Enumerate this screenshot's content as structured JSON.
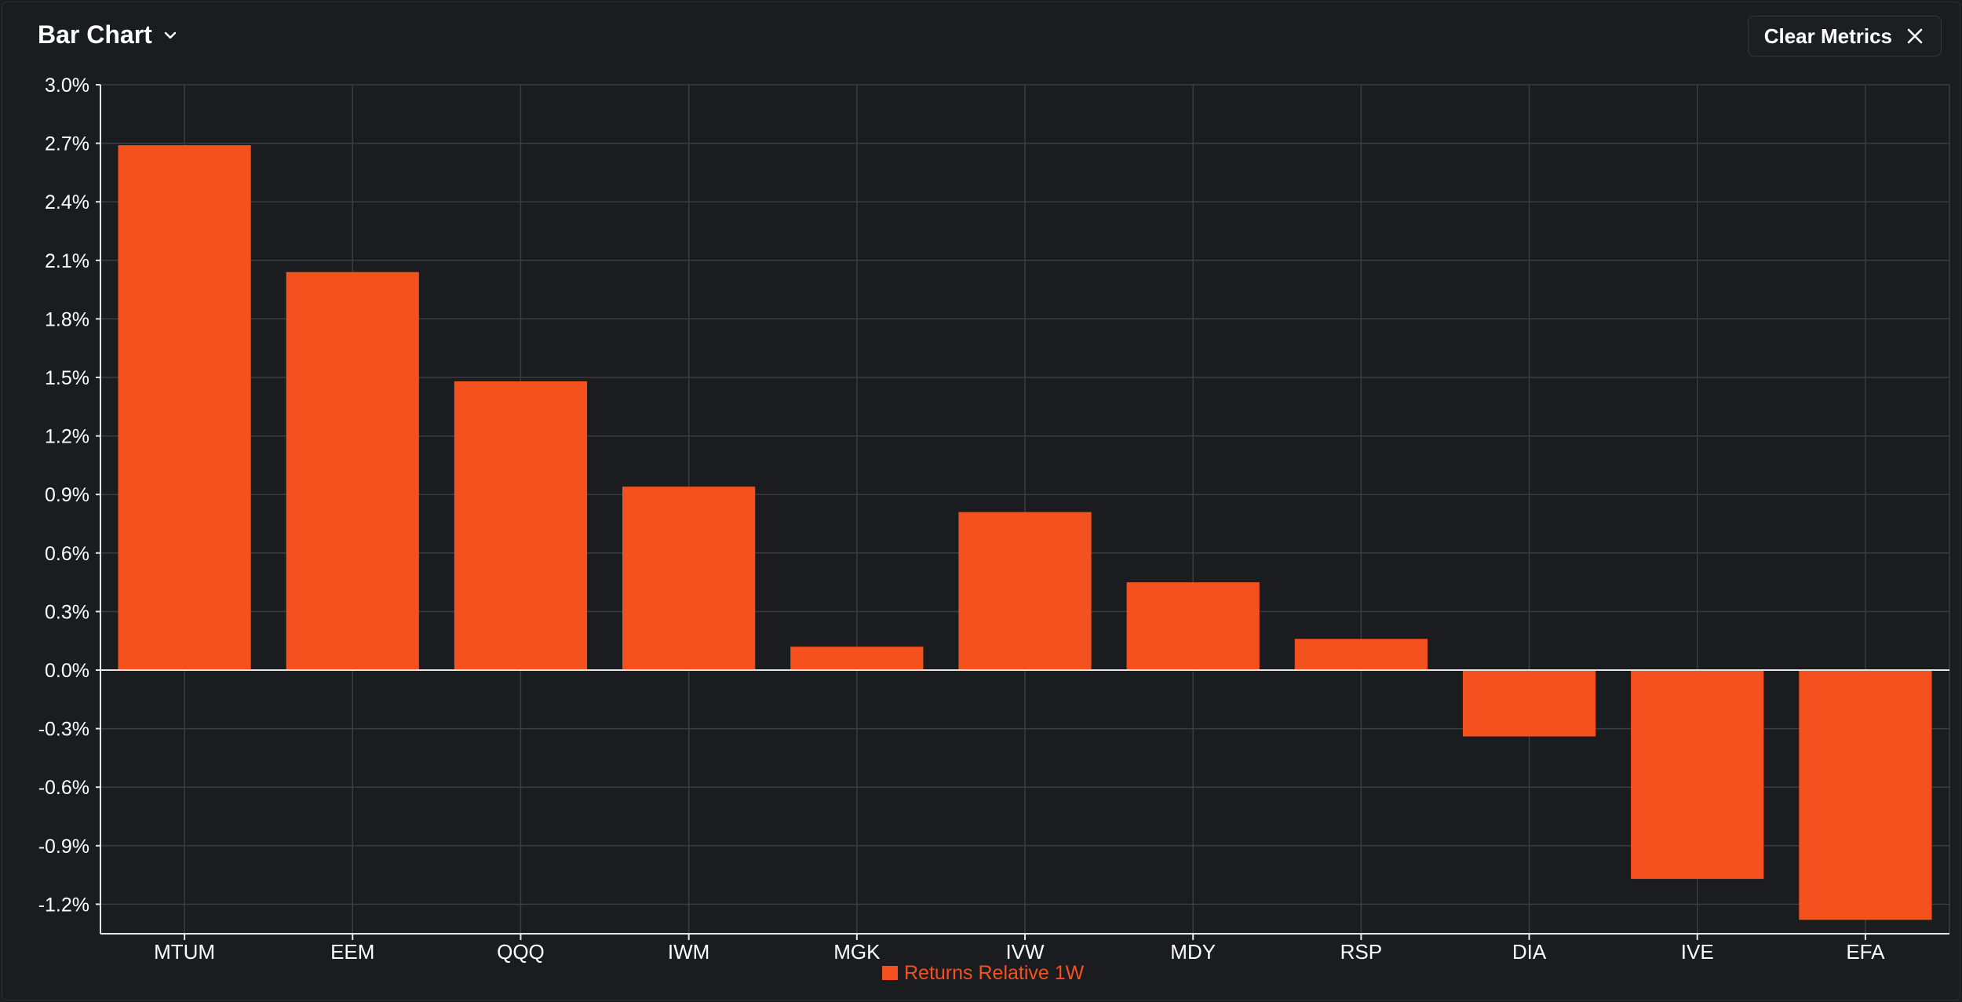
{
  "header": {
    "title": "Bar Chart",
    "title_icon": "chevron-down-icon",
    "clear_label": "Clear Metrics",
    "clear_icon": "close-icon"
  },
  "colors": {
    "bar": "#f4511e",
    "background": "#1b1c1f",
    "grid": "#3a3d42",
    "axis": "#e6e6e6",
    "text": "#ffffff"
  },
  "chart_data": {
    "type": "bar",
    "categories": [
      "MTUM",
      "EEM",
      "QQQ",
      "IWM",
      "MGK",
      "IVW",
      "MDY",
      "RSP",
      "DIA",
      "IVE",
      "EFA"
    ],
    "series": [
      {
        "name": "Returns Relative 1W",
        "values": [
          2.69,
          2.04,
          1.48,
          0.94,
          0.12,
          0.81,
          0.45,
          0.16,
          -0.34,
          -1.07,
          -1.28
        ]
      }
    ],
    "yticks": [
      3.0,
      2.7,
      2.4,
      2.1,
      1.8,
      1.5,
      1.2,
      0.9,
      0.6,
      0.3,
      0.0,
      -0.3,
      -0.6,
      -0.9,
      -1.2
    ],
    "ytick_labels": [
      "3.0%",
      "2.7%",
      "2.4%",
      "2.1%",
      "1.8%",
      "1.5%",
      "1.2%",
      "0.9%",
      "0.6%",
      "0.3%",
      "0.0%",
      "-0.3%",
      "-0.6%",
      "-0.9%",
      "-1.2%"
    ],
    "ylim": [
      -1.35,
      3.0
    ],
    "grid": true,
    "legend_position": "bottom-center"
  }
}
